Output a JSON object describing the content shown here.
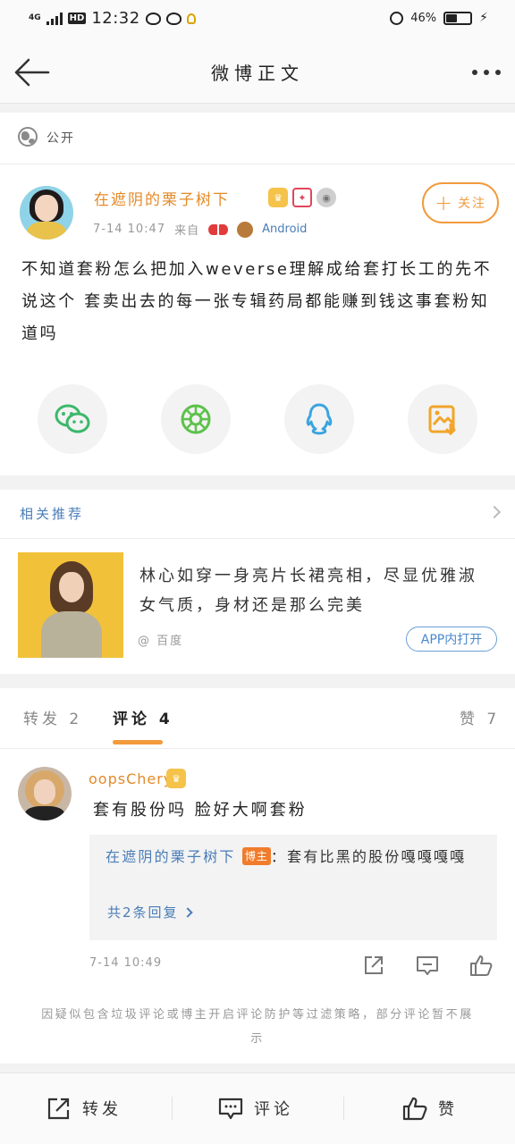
{
  "status_bar": {
    "network": "4G",
    "hd": "HD",
    "time": "12:32",
    "battery_percent": "46%",
    "battery_level": 0.46
  },
  "nav": {
    "title": "微博正文"
  },
  "visibility": {
    "label": "公开"
  },
  "post": {
    "username": "在遮阴的栗子树下",
    "time": "7-14 10:47",
    "source_prefix": "来自",
    "device": "Android",
    "follow_label": "关注",
    "text": "不知道套粉怎么把加入weverse理解成给套打长工的先不说这个 套卖出去的每一张专辑药局都能赚到钱这事套粉知道吗"
  },
  "share": {
    "icons": [
      "wechat-icon",
      "moments-icon",
      "qq-icon",
      "save-image-icon"
    ]
  },
  "related": {
    "title": "相关推荐",
    "item_text": "林心如穿一身亮片长裙亮相，尽显优雅淑女气质，身材还是那么完美",
    "item_source": "@ 百度",
    "app_open_label": "APP内打开"
  },
  "tabs": {
    "repost_label": "转发",
    "repost_count": "2",
    "comment_label": "评论",
    "comment_count": "4",
    "like_label": "赞",
    "like_count": "7"
  },
  "comment": {
    "username": "oopsCheryl",
    "text": "套有股份吗 脸好大啊套粉",
    "reply_user": "在遮阴的栗子树下",
    "reply_tag": "博主",
    "reply_text": "：套有比黑的股份嘎嘎嘎嘎",
    "reply_more": "共2条回复",
    "time": "7-14 10:49"
  },
  "notice": {
    "text": "因疑似包含垃圾评论或博主开启评论防护等过滤策略，部分评论暂不展示"
  },
  "bottom_bar": {
    "repost_label": "转发",
    "comment_label": "评论",
    "like_label": "赞"
  },
  "colors": {
    "accent": "#f29a3c",
    "link": "#4a7db7",
    "username": "#e48a28"
  }
}
